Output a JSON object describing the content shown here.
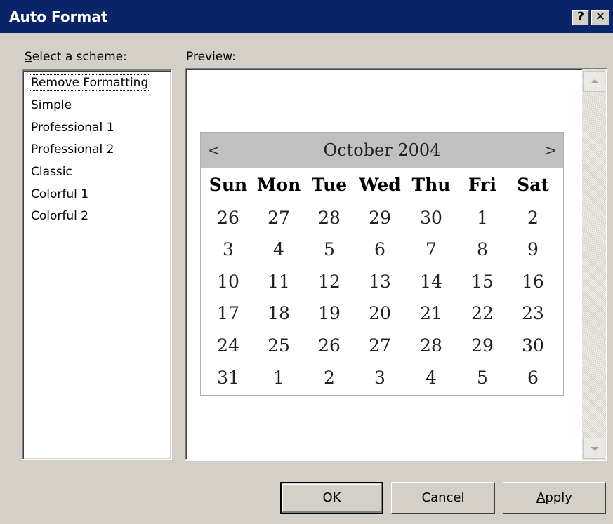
{
  "window": {
    "title": "Auto Format",
    "help_label": "?",
    "close_label": "✕"
  },
  "scheme": {
    "label_first": "S",
    "label_rest": "elect a scheme:",
    "items": [
      "Remove Formatting",
      "Simple",
      "Professional 1",
      "Professional 2",
      "Classic",
      "Colorful 1",
      "Colorful 2"
    ],
    "selected": "Remove Formatting"
  },
  "preview": {
    "label": "Preview:"
  },
  "calendar": {
    "prev": "<",
    "next": ">",
    "title": "October 2004",
    "days": [
      "Sun",
      "Mon",
      "Tue",
      "Wed",
      "Thu",
      "Fri",
      "Sat"
    ],
    "weeks": [
      [
        "26",
        "27",
        "28",
        "29",
        "30",
        "1",
        "2"
      ],
      [
        "3",
        "4",
        "5",
        "6",
        "7",
        "8",
        "9"
      ],
      [
        "10",
        "11",
        "12",
        "13",
        "14",
        "15",
        "16"
      ],
      [
        "17",
        "18",
        "19",
        "20",
        "21",
        "22",
        "23"
      ],
      [
        "24",
        "25",
        "26",
        "27",
        "28",
        "29",
        "30"
      ],
      [
        "31",
        "1",
        "2",
        "3",
        "4",
        "5",
        "6"
      ]
    ]
  },
  "buttons": {
    "ok": "OK",
    "cancel": "Cancel",
    "apply_first": "A",
    "apply_rest": "pply"
  }
}
